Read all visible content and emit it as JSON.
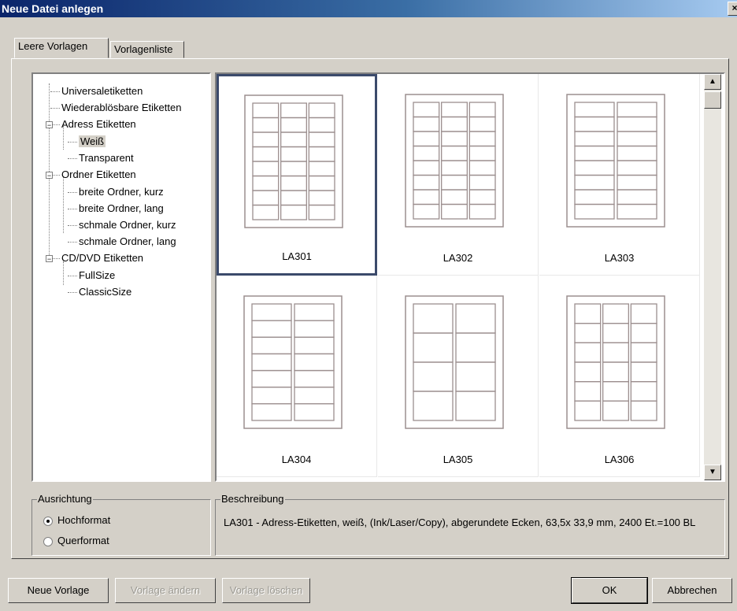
{
  "window": {
    "title": "Neue Datei anlegen",
    "close_glyph": "×"
  },
  "tabs": [
    {
      "label": "Leere Vorlagen",
      "active": true
    },
    {
      "label": "Vorlagenliste",
      "active": false
    }
  ],
  "tree": [
    {
      "label": "Universaletiketten"
    },
    {
      "label": "Wiederablösbare Etiketten"
    },
    {
      "label": "Adress Etiketten",
      "expander": "−"
    },
    {
      "label": "Weiß",
      "selected": true
    },
    {
      "label": "Transparent"
    },
    {
      "label": "Ordner Etiketten",
      "expander": "−"
    },
    {
      "label": "breite Ordner, kurz"
    },
    {
      "label": "breite Ordner, lang"
    },
    {
      "label": "schmale Ordner, kurz"
    },
    {
      "label": "schmale Ordner, lang"
    },
    {
      "label": "CD/DVD Etiketten",
      "expander": "−"
    },
    {
      "label": "FullSize"
    },
    {
      "label": "ClassicSize"
    }
  ],
  "templates": [
    {
      "name": "LA301",
      "cols": 3,
      "rows": 8
    },
    {
      "name": "LA302",
      "cols": 3,
      "rows": 8
    },
    {
      "name": "LA303",
      "cols": 2,
      "rows": 8
    },
    {
      "name": "LA304",
      "cols": 2,
      "rows": 7
    },
    {
      "name": "LA305",
      "cols": 2,
      "rows": 4
    },
    {
      "name": "LA306",
      "cols": 3,
      "rows": 6
    }
  ],
  "scrollbar": {
    "up_glyph": "▲",
    "down_glyph": "▼"
  },
  "orientation": {
    "legend": "Ausrichtung",
    "options": [
      {
        "label": "Hochformat",
        "checked": true
      },
      {
        "label": "Querformat",
        "checked": false
      }
    ]
  },
  "description": {
    "legend": "Beschreibung",
    "text": "LA301 - Adress-Etiketten, weiß, (Ink/Laser/Copy), abgerundete Ecken, 63,5x 33,9 mm, 2400 Et.=100 BL"
  },
  "buttons": {
    "new_template": "Neue Vorlage",
    "edit_template": "Vorlage ändern",
    "delete_template": "Vorlage löschen",
    "ok": "OK",
    "cancel": "Abbrechen"
  },
  "colors": {
    "title_start": "#0a246a",
    "title_end": "#a6caf0",
    "selection_border": "#3b4a6b",
    "sheet_line": "#9c8f8f"
  }
}
